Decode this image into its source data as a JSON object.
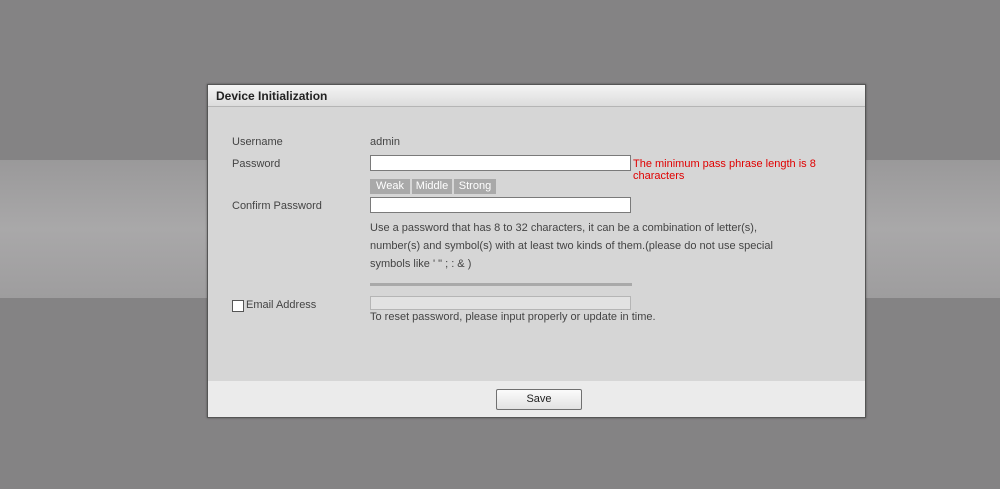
{
  "dialog": {
    "title": "Device Initialization",
    "username_label": "Username",
    "username_value": "admin",
    "password_label": "Password",
    "password_value": "",
    "password_error": "The minimum pass phrase length is 8 characters",
    "strength": [
      "Weak",
      "Middle",
      "Strong"
    ],
    "confirm_label": "Confirm Password",
    "confirm_value": "",
    "hint_lines": [
      "Use a password that has 8 to 32 characters, it can be a combination of letter(s),",
      "number(s) and symbol(s) with at least two kinds of them.(please do not use special",
      "symbols like ' \" ; : & )"
    ],
    "email_label": "Email Address",
    "email_checked": false,
    "email_value": "",
    "email_hint": "To reset password, please input properly or update in time.",
    "save_label": "Save"
  },
  "colors": {
    "background": "#848384",
    "dialog": "#d6d6d6",
    "error": "#e00000",
    "strength_bar": "#a9a9a9"
  }
}
